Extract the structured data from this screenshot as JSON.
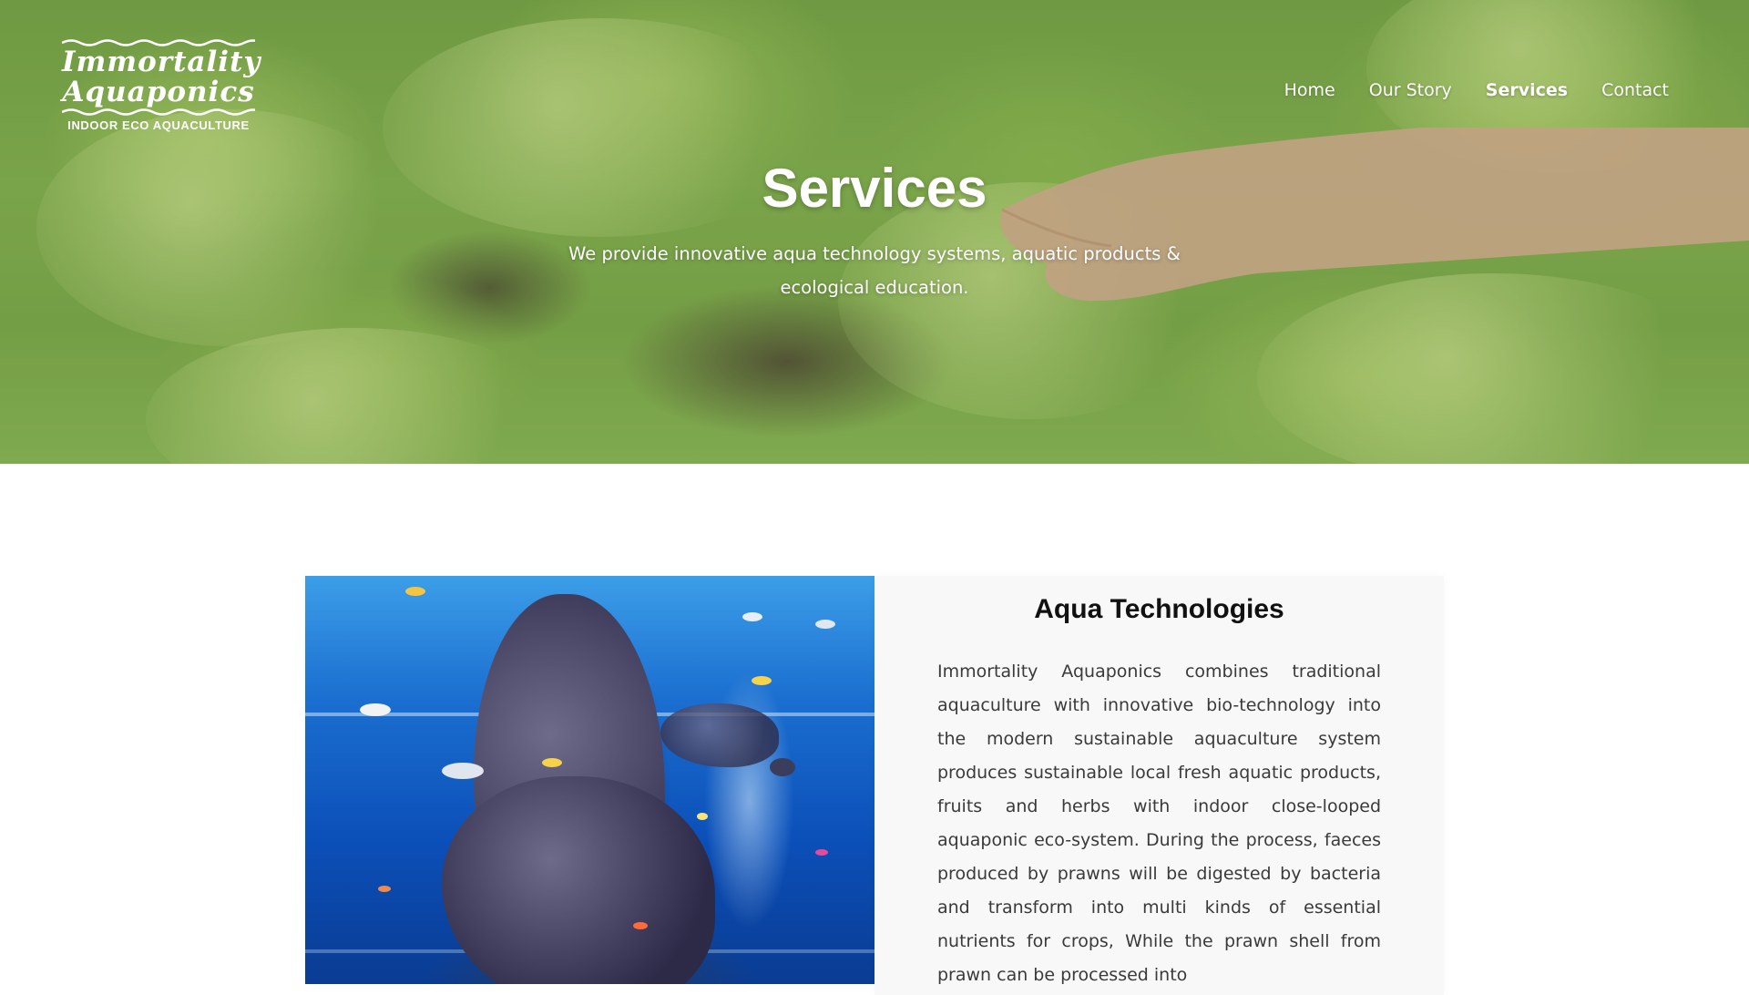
{
  "brand": {
    "line1": "Immortality",
    "line2": "Aquaponics",
    "tagline": "INDOOR ECO AQUACULTURE"
  },
  "nav": {
    "items": [
      {
        "label": "Home",
        "active": false
      },
      {
        "label": "Our Story",
        "active": false
      },
      {
        "label": "Services",
        "active": true
      },
      {
        "label": "Contact",
        "active": false
      }
    ]
  },
  "hero": {
    "title": "Services",
    "subtitle": "We provide innovative aqua technology systems, aquatic products & ecological education."
  },
  "services": [
    {
      "title": "Aqua Technologies",
      "description": "Immortality Aquaponics combines traditional aquaculture with innovative bio-technology into the modern sustainable aquaculture system produces sustainable local fresh aquatic products, fruits and herbs with indoor close-looped aquaponic eco-system. During the process, faeces produced by prawns will be digested by bacteria and transform into multi kinds of essential nutrients for crops, While the prawn shell from prawn can be processed into"
    }
  ],
  "colors": {
    "hero_green": "#8dbb56",
    "text_white": "#ffffff",
    "panel_bg": "#f9f8f8",
    "heading": "#111111",
    "body_text": "#3a3a3a"
  }
}
